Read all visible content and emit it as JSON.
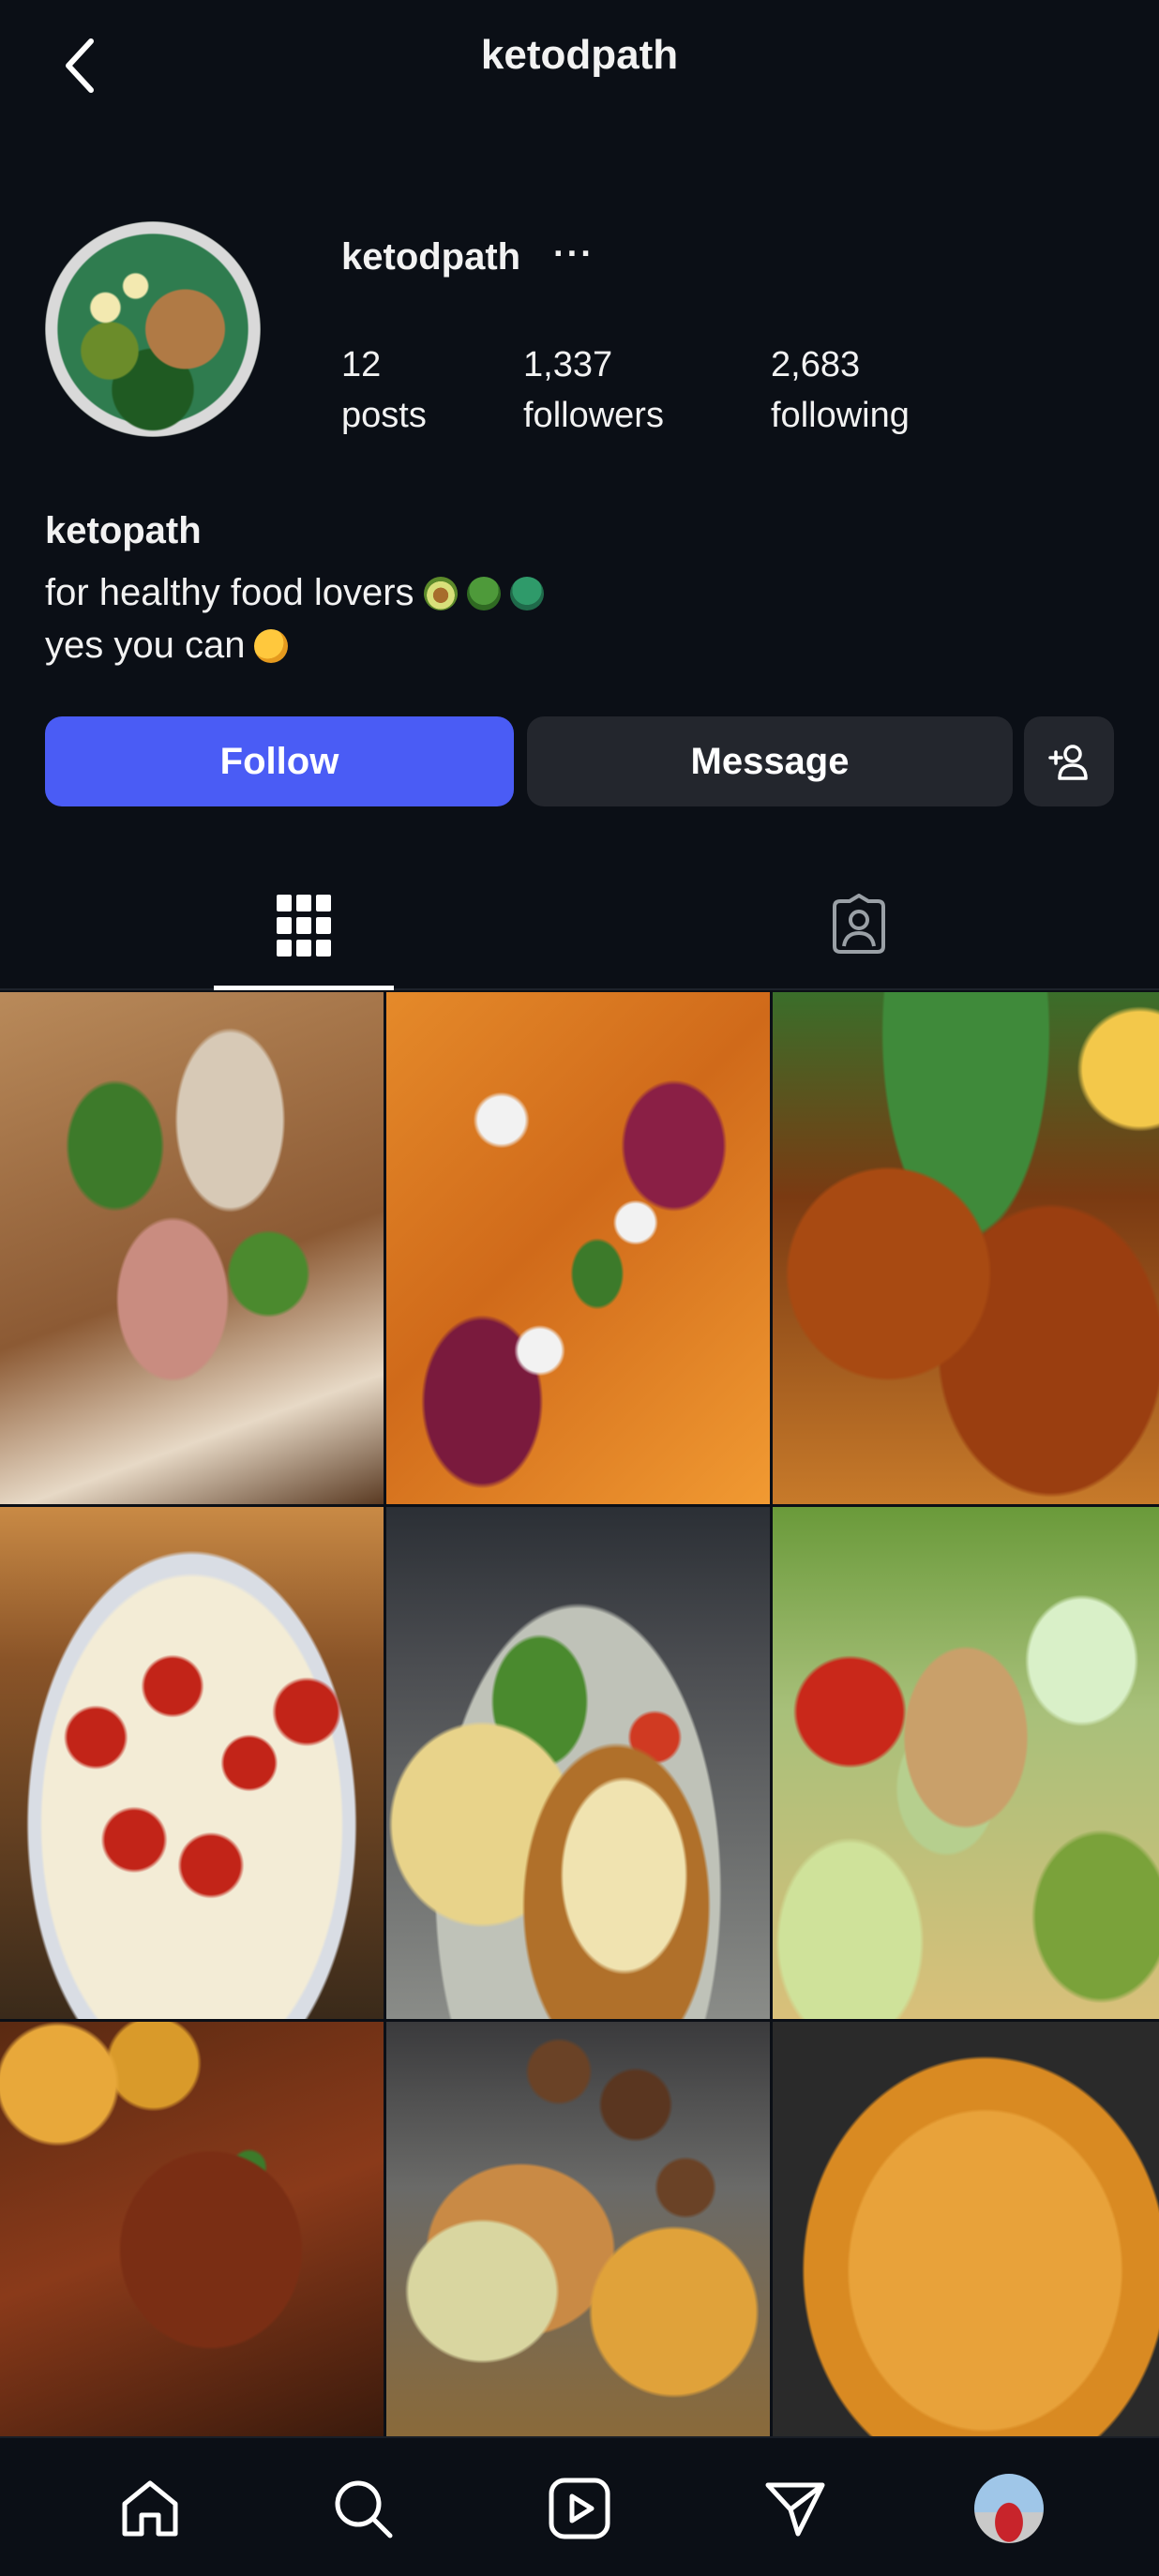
{
  "header": {
    "title": "ketodpath",
    "back_icon": "chevron-left-icon"
  },
  "profile": {
    "username": "ketodpath",
    "more_label": "···",
    "stats": [
      {
        "value": "12",
        "label": "posts"
      },
      {
        "value": "1,337",
        "label": "followers"
      },
      {
        "value": "2,683",
        "label": "following"
      }
    ]
  },
  "bio": {
    "name": "ketopath",
    "line1": "for healthy food lovers",
    "line2": "yes you can",
    "emojis_line1": [
      "avocado-emoji",
      "broccoli-emoji",
      "broccoli-emoji"
    ],
    "emojis_line2": [
      "flexed-biceps-emoji"
    ]
  },
  "actions": {
    "follow_label": "Follow",
    "message_label": "Message",
    "add_user_icon": "add-person-icon"
  },
  "tabs": [
    {
      "name": "posts",
      "icon": "grid-icon",
      "active": true
    },
    {
      "name": "tagged",
      "icon": "tagged-person-icon",
      "active": false
    }
  ],
  "posts": [
    {
      "subject": "prosciutto flatbread with arugula and balsamic"
    },
    {
      "subject": "roasted squash and beet salad with feta"
    },
    {
      "subject": "glazed chicken thighs"
    },
    {
      "subject": "baked cherry tomatoes with cheese"
    },
    {
      "subject": "chicken parmesan with spaghetti"
    },
    {
      "subject": "grilled chicken salad with avocado dressing"
    },
    {
      "subject": "braised beef with potatoes"
    },
    {
      "subject": "chicken with mushrooms and potatoes"
    },
    {
      "subject": "creamy pasta"
    }
  ],
  "bottom_nav": [
    {
      "name": "home",
      "icon": "home-icon"
    },
    {
      "name": "search",
      "icon": "search-icon"
    },
    {
      "name": "reels",
      "icon": "reels-icon"
    },
    {
      "name": "direct",
      "icon": "send-icon"
    },
    {
      "name": "profile",
      "icon": "avatar"
    }
  ],
  "colors": {
    "background": "#0b0f16",
    "follow_button": "#4a5cf5",
    "secondary_button": "#23262d"
  }
}
